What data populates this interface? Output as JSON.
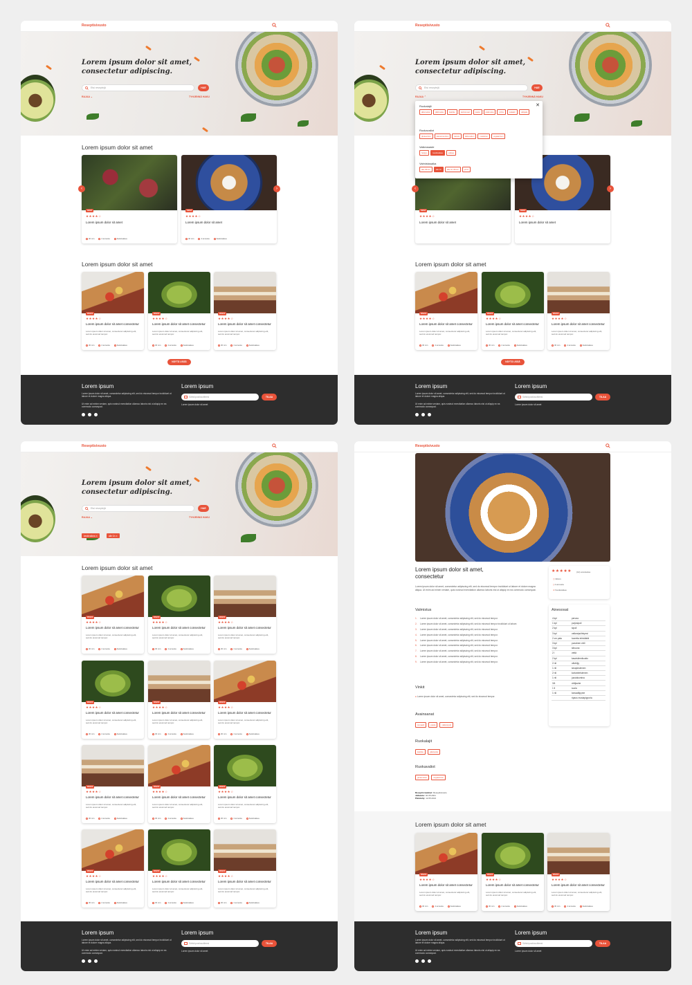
{
  "brand": {
    "logo": "Reseptisivusto",
    "accent": "#e8533a",
    "footer_bg": "#2d2d2d"
  },
  "hero": {
    "title_line1": "Lorem ipsum dolor sit amet,",
    "title_line2": "consectetur adipiscing.",
    "search_placeholder": "Etsi reseptejä",
    "search_button": "HAE",
    "refine_label": "RAJAA",
    "clear_label": "TYHJENNÄ HAKU"
  },
  "sections": {
    "featured": "Lorem ipsum dolor sit amet",
    "latest": "Lorem ipsum dolor sit amet",
    "results": "Lorem ipsum dolor sit amet",
    "related": "Lorem ipsum dolor sit amet"
  },
  "show_more": "NÄYTÄ LISÄÄ",
  "featured_cards": [
    {
      "tag": "KESÄ",
      "rating": 4,
      "title": "Lorem ipsum dolor sit amet",
      "time": "30 min",
      "servings": "4 annosta",
      "difficulty": "Keskivaikea"
    },
    {
      "tag": "KESÄ",
      "rating": 4,
      "title": "Lorem ipsum dolor sit amet",
      "time": "30 min",
      "servings": "4 annosta",
      "difficulty": "Keskivaikea"
    }
  ],
  "card_common": {
    "tag": "PASTA",
    "rating": 4,
    "title": "Lorem ipsum dolor sit amet consectetur",
    "desc": "Lorem ipsum dolor sit amet, consectetur adipiscing elit, sed do eiusmod tempor.",
    "time": "30 min",
    "servings": "4 annosta",
    "difficulty": "Keskivaikea"
  },
  "filter_popup": {
    "groups": [
      {
        "title": "Ruokalajit",
        "chips": [
          "alkuruoka",
          "jälkiruoka",
          "kastike",
          "keittoruoat",
          "pasta",
          "pääruoka",
          "pizza",
          "salaatti",
          "välipala"
        ]
      },
      {
        "title": "Ruokavaliot",
        "chips": [
          "gluteeniton",
          "kananmuniton",
          "kasvis",
          "laktoositon",
          "maidoton",
          "vegaaninen"
        ]
      },
      {
        "title": "Vaikeusaste",
        "chips": [
          "helppo",
          "keskivaikea",
          "vaikea"
        ],
        "selected": "keskivaikea"
      },
      {
        "title": "Valmistusaika",
        "chips": [
          "alle 30min",
          "alle 1h",
          "alle 1h 30min",
          "yli 1h"
        ],
        "selected": "alle 1h"
      }
    ]
  },
  "active_filters": [
    "keskivaikea ✕",
    "alle 1h ✕"
  ],
  "footer": {
    "col1_title": "Lorem ipsum",
    "col1_text1": "Lorem ipsum dolor sit amet, consectetur adipiscing elit, sed do eiusmod tempor incididunt ut labore et dolore magna aliqua.",
    "col1_text2": "Ut enim ad minim veniam, quis nostrud exercitation ullamco laboris nisi ut aliquip ex ea commodo consequat.",
    "col2_title": "Lorem ipsum",
    "email_placeholder": "Sähköpostiosoitteesi",
    "subscribe": "TILAA",
    "col2_text": "Lorem ipsum dolor sit amet"
  },
  "recipe": {
    "title_line1": "Lorem ipsum dolor sit amet,",
    "title_line2": "consectetur",
    "desc": "Lorem ipsum dolor sit amet, consectetur adipiscing elit, sed do eiusmod tempor incididunt ut labore et dolore magna aliqua. Ut enim ad minim veniam, quis nostrud exercitation ullamco laboris nisi ut aliquip ex ea commodo consequat.",
    "rating_count": "(12) arvostelua",
    "time": "30min",
    "servings": "4 annosta",
    "difficulty": "Keskivaikea",
    "steps_title": "Valmistus",
    "steps": [
      "Lorem ipsum dolor sit amet, consectetur adipiscing elit, sed do eiusmod tempor.",
      "Lorem ipsum dolor sit amet, consectetur adipiscing elit, sed do eiusmod tempor incididunt ut labore.",
      "Lorem ipsum dolor sit amet, consectetur adipiscing elit, sed do eiusmod tempor.",
      "Lorem ipsum dolor sit amet, consectetur adipiscing elit, sed do eiusmod tempor.",
      "Lorem ipsum dolor sit amet, consectetur adipiscing elit, sed do eiusmod tempor.",
      "Lorem ipsum dolor sit amet, consectetur adipiscing elit, sed do eiusmod tempor.",
      "Lorem ipsum dolor sit amet, consectetur adipiscing elit, sed do eiusmod tempor.",
      "Lorem ipsum dolor sit amet, consectetur adipiscing elit, sed do eiusmod tempor.",
      "Lorem ipsum dolor sit amet, consectetur adipiscing elit, sed do eiusmod tempor."
    ],
    "tips_title": "Vinkit",
    "tip": "Lorem ipsum dolor sit amet, consectetur adipiscing elit, sed do eiusmod tempor.",
    "keywords_title": "Avainsanat",
    "keywords": [
      "tomaatti",
      "pasta",
      "valkosipuli"
    ],
    "dishes_title": "Ruokalajit",
    "dishes": [
      "kastike",
      "pääruoka"
    ],
    "diets_title": "Ruokavaliot",
    "diets": [
      "gluteeniton",
      "vegaaninen"
    ],
    "author_label": "Reseptin laatinut:",
    "author": "Reseptisivusto",
    "published_label": "Julkaistu:",
    "published": "02.05.2021",
    "updated_label": "Päivitetty:",
    "updated": "12.05.2021",
    "ingredients_title": "Ainesosat",
    "ingredients": [
      [
        "4 kpl",
        "peruna"
      ],
      [
        "1 kpl",
        "purjosipuli"
      ],
      [
        "2 kpl",
        "sipuli"
      ],
      [
        "3 kpl",
        "valkosipulinkynsi"
      ],
      [
        "2 cm pala",
        "tuoretta inkivääriä"
      ],
      [
        "3 kpl",
        "punainen chili"
      ],
      [
        "3 kpl",
        "sitruuna"
      ],
      [
        "2 l",
        "vettä"
      ],
      [
        "2 kpl",
        "kasvisliemikuutio"
      ],
      [
        "2 rkl",
        "oliiviöljy"
      ],
      [
        "1 rkl",
        "sinapinsiemen"
      ],
      [
        "2 rkl",
        "korianterisiemen"
      ],
      [
        "1 rkl",
        "juustokumina"
      ],
      [
        "3/4",
        "chilijauhe"
      ],
      [
        "1 tl",
        "suola"
      ],
      [
        "1 rkl",
        "tomaattipyree"
      ],
      [
        "",
        "ripaus mustapippuria"
      ]
    ]
  }
}
